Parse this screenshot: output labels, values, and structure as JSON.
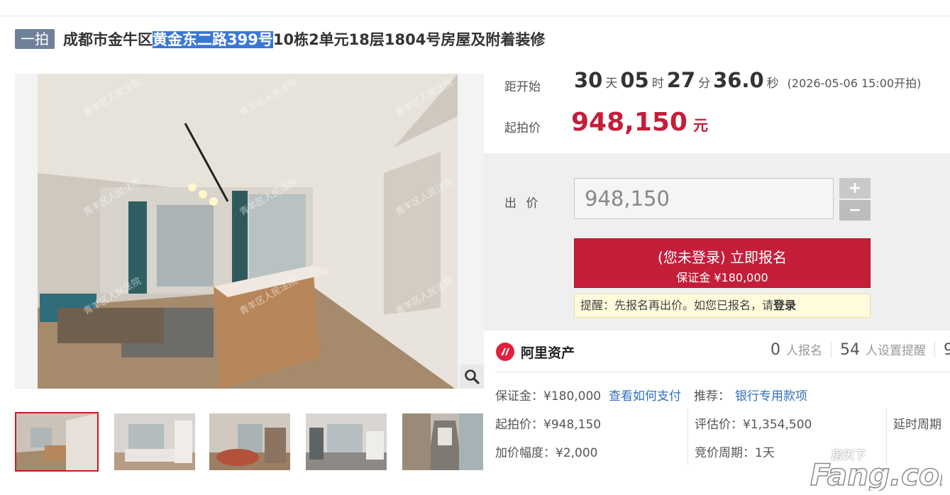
{
  "title": {
    "stage": "一拍",
    "prefix": "成都市金牛区",
    "highlight": "黄金东二路399号",
    "suffix": "10栋2单元18层1804号房屋及附着装修"
  },
  "photo": {
    "watermark": "青羊区人民法院"
  },
  "thumbnails": [
    "thumb-1",
    "thumb-2",
    "thumb-3",
    "thumb-4",
    "thumb-5"
  ],
  "countdown": {
    "label": "距开始",
    "days": "30",
    "days_unit": "天",
    "hours": "05",
    "hours_unit": "时",
    "minutes": "27",
    "minutes_unit": "分",
    "seconds": "36.0",
    "seconds_unit": "秒",
    "start_time": "(2026-05-06 15:00开拍)"
  },
  "start_price": {
    "label": "起拍价",
    "value": "948,150",
    "unit": "元"
  },
  "bid": {
    "label": "出 价",
    "value": "948,150",
    "plus": "+",
    "minus": "−",
    "signup_main": "(您未登录) 立即报名",
    "signup_sub": "保证金 ¥180,000",
    "notice_prefix": "提醒：先报名再出价。如您已报名，请",
    "notice_link": "登录"
  },
  "platform": {
    "name": "阿里资产",
    "signup_count": "0",
    "signup_label": "人报名",
    "reminder_count": "54",
    "reminder_label": "人设置提醒",
    "watch_count": "9"
  },
  "details": {
    "deposit": "保证金：¥180,000",
    "pay_link": "查看如何支付",
    "recommend_label": "推荐：",
    "recommend_link": "银行专用款项",
    "start_price": "起拍价：¥948,150",
    "appraisal": "评估价：¥1,354,500",
    "delay": "延时周期",
    "increment": "加价幅度：¥2,000",
    "cycle": "竞价周期：1天"
  },
  "watermark": {
    "small": "房天下",
    "big": "Fang.com"
  },
  "colors": {
    "brand_red": "#c41e3a",
    "link_blue": "#2f6fbd",
    "badge_gray": "#6f8199",
    "highlight_blue": "#3a78d6"
  },
  "icons": [
    "zoom-icon",
    "ali-asset-logo-icon",
    "plus-icon",
    "minus-icon"
  ]
}
